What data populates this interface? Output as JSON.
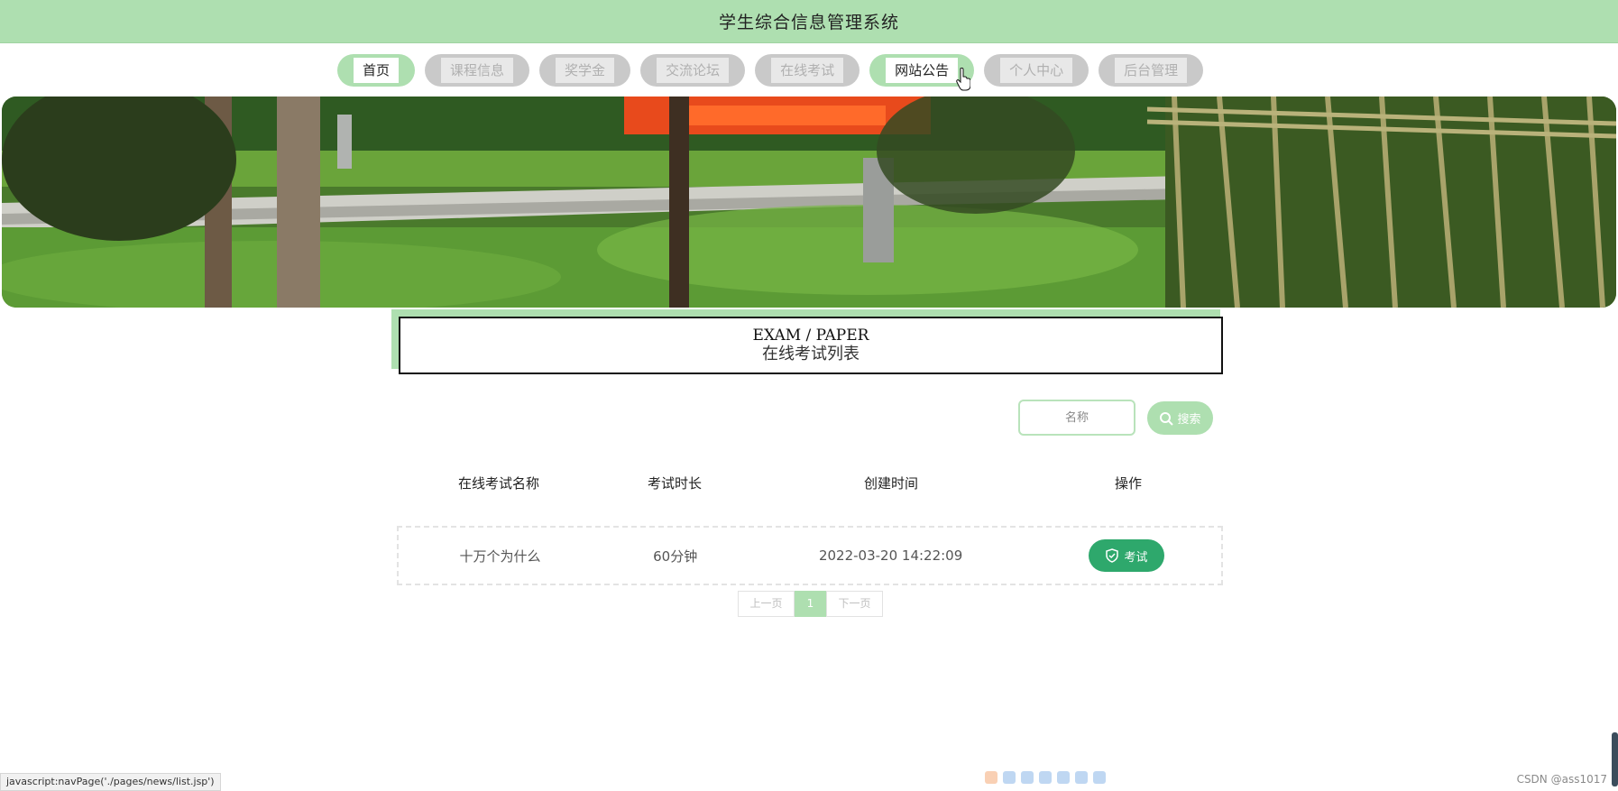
{
  "header": {
    "title": "学生综合信息管理系统"
  },
  "nav": {
    "items": [
      {
        "label": "首页"
      },
      {
        "label": "课程信息"
      },
      {
        "label": "奖学金"
      },
      {
        "label": "交流论坛"
      },
      {
        "label": "在线考试"
      },
      {
        "label": "网站公告"
      },
      {
        "label": "个人中心"
      },
      {
        "label": "后台管理"
      }
    ]
  },
  "section": {
    "title_en": "EXAM / PAPER",
    "title_cn": "在线考试列表"
  },
  "search": {
    "placeholder": "名称",
    "value": "",
    "button_label": "搜索"
  },
  "table": {
    "headers": [
      "在线考试名称",
      "考试时长",
      "创建时间",
      "操作"
    ],
    "rows": [
      {
        "name": "十万个为什么",
        "duration": "60分钟",
        "created": "2022-03-20 14:22:09",
        "action": "考试"
      }
    ]
  },
  "pagination": {
    "prev": "上一页",
    "current": "1",
    "next": "下一页"
  },
  "statusbar": {
    "text": "javascript:navPage('./pages/news/list.jsp')"
  },
  "watermark": {
    "text": "CSDN @ass1017"
  },
  "colors": {
    "accent": "#aedfb0",
    "primary_button": "#2ea86c"
  }
}
